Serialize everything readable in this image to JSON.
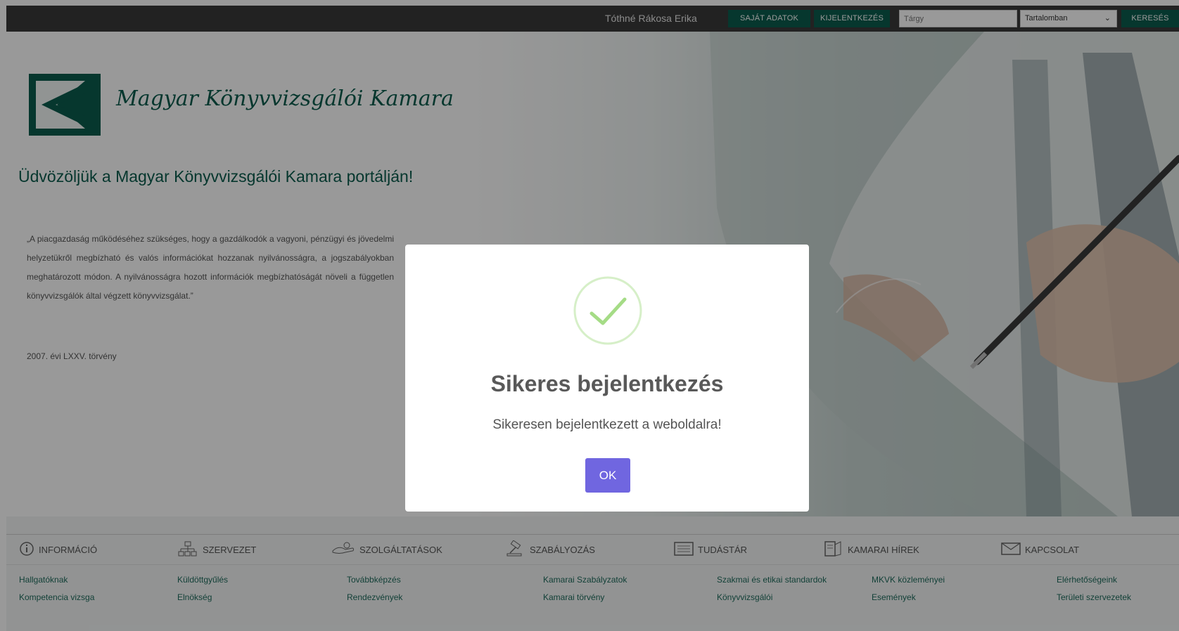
{
  "header": {
    "username": "Tóthné Rákosa Erika",
    "own_data_button": "SAJÁT ADATOK",
    "logout_button": "KIJELENTKEZÉS",
    "search_placeholder": "Tárgy",
    "search_scope": "Tartalomban",
    "search_button": "KERESÉS"
  },
  "brand": {
    "name": "Magyar Könyvvizsgálói Kamara"
  },
  "hero": {
    "welcome": "Üdvözöljük a Magyar Könyvvizsgálói Kamara portálján!",
    "quote": "„A piacgazdaság működéséhez szükséges, hogy a gazdálkodók a vagyoni, pénzügyi és jövedelmi helyzetükről megbízható és valós információkat hozzanak nyilvánosságra, a jogszabályokban meghatározott módon. A nyilvánosságra hozott információk megbízhatóságát növeli a független könyvvizsgálók által végzett könyvvizsgálat.”",
    "law": "2007. évi LXXV. törvény"
  },
  "menu": {
    "categories": [
      {
        "label": "INFORMÁCIÓ",
        "icon": "info-icon",
        "links": [
          "Hallgatóknak",
          "Kompetencia vizsga"
        ]
      },
      {
        "label": "SZERVEZET",
        "icon": "org-chart-icon",
        "links": [
          "Küldöttgyűlés",
          "Elnökség"
        ]
      },
      {
        "label": "SZOLGÁLTATÁSOK",
        "icon": "hand-icon",
        "links": [
          "Továbbképzés",
          "Rendezvények"
        ]
      },
      {
        "label": "SZABÁLYOZÁS",
        "icon": "gavel-icon",
        "links": [
          "Kamarai Szabályzatok",
          "Kamarai törvény"
        ]
      },
      {
        "label": "TUDÁSTÁR",
        "icon": "keyboard-icon",
        "links": [
          "Szakmai és etikai standardok",
          "Könyvvizsgálói"
        ]
      },
      {
        "label": "KAMARAI HÍREK",
        "icon": "news-icon",
        "links": [
          "MKVK közleményei",
          "Események"
        ]
      },
      {
        "label": "KAPCSOLAT",
        "icon": "envelope-icon",
        "links": [
          "Elérhetőségeink",
          "Területi szervezetek"
        ]
      }
    ]
  },
  "modal": {
    "title": "Sikeres bejelentkezés",
    "message": "Sikeresen bejelentkezett a weboldalra!",
    "ok_button": "OK"
  },
  "colors": {
    "brand_green": "#0b5c4d",
    "topbar": "#3a3a3a",
    "ok_button": "#7066e0",
    "success_check": "#a5dc86"
  }
}
